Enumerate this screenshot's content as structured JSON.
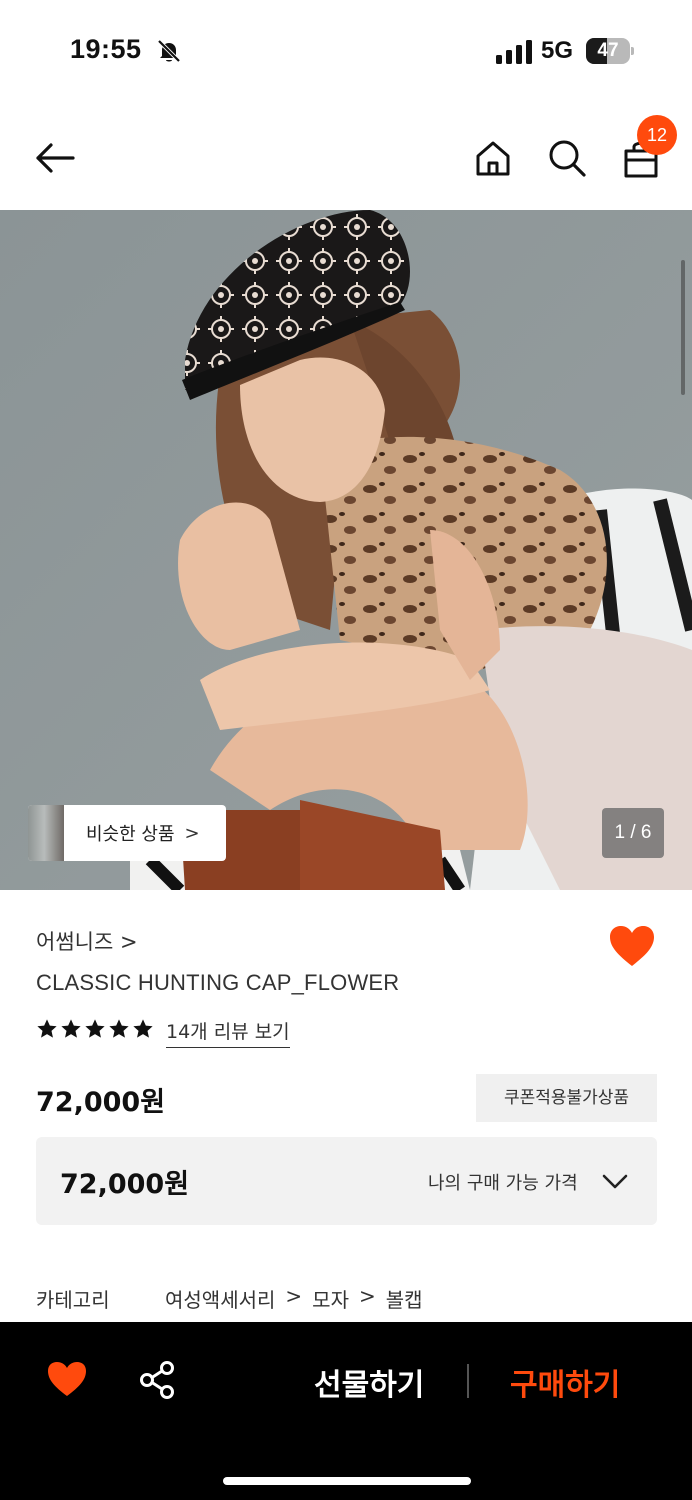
{
  "status_bar": {
    "time": "19:55",
    "network": "5G",
    "battery": "47",
    "battery_level": 0.47
  },
  "header": {
    "cart_count": "12",
    "icons": [
      "back-arrow-icon",
      "home-icon",
      "search-icon",
      "shopping-bag-icon"
    ]
  },
  "hero": {
    "similar_label": "비슷한 상품",
    "similar_chevron": ">",
    "counter": "1 / 6"
  },
  "product": {
    "brand": "어썸니즈",
    "brand_chevron": ">",
    "title": "CLASSIC HUNTING CAP_FLOWER",
    "rating_stars": 5,
    "review_link": "14개 리뷰 보기",
    "price": "72,000원",
    "coupon_badge": "쿠폰적용불가상품",
    "my_price_value": "72,000원",
    "my_price_label": "나의 구매 가능 가격"
  },
  "category": {
    "label": "카테고리",
    "path": [
      "여성액세서리",
      "모자",
      "볼캡"
    ],
    "separator": ">"
  },
  "bottom_bar": {
    "gift_label": "선물하기",
    "buy_label": "구매하기"
  },
  "colors": {
    "accent": "#ff4a0d",
    "bottom_bar": "#000000",
    "badge_bg": "#f0f0f0"
  }
}
